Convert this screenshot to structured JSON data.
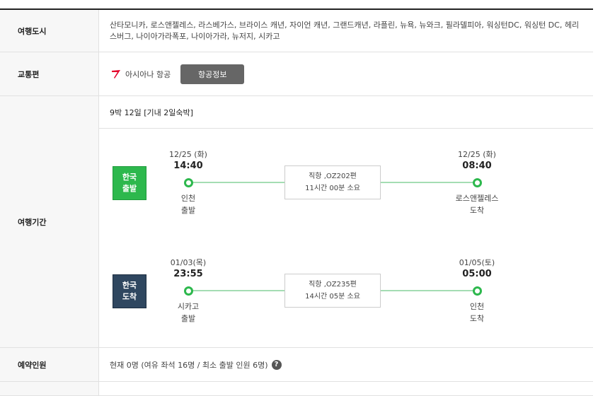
{
  "cities": {
    "label": "여행도시",
    "value": "산타모니카, 로스앤젤레스, 라스베가스, 브라이스 캐년, 자이언 캐년, 그랜드캐년, 라플린, 뉴욕, 뉴와크, 필라델피아, 워싱턴DC, 워싱턴 DC, 헤리스버그, 나이아가라폭포, 나이아가라, 뉴저지, 시카고"
  },
  "transport": {
    "label": "교통편",
    "airline": "아시아나 항공",
    "button": "항공정보"
  },
  "period": {
    "label": "여행기간",
    "duration": "9박 12일 [기내 2일숙박]",
    "departure": {
      "badge_line1": "한국",
      "badge_line2": "출발",
      "from_date": "12/25 (화)",
      "from_time": "14:40",
      "from_place": "인천",
      "from_action": "출발",
      "flight": "직항 ,OZ202편",
      "flight_time": "11시간 00분 소요",
      "to_date": "12/25 (화)",
      "to_time": "08:40",
      "to_place": "로스앤젤레스",
      "to_action": "도착"
    },
    "return": {
      "badge_line1": "한국",
      "badge_line2": "도착",
      "from_date": "01/03(목)",
      "from_time": "23:55",
      "from_place": "시카고",
      "from_action": "출발",
      "flight": "직항 ,OZ235편",
      "flight_time": "14시간 05분 소요",
      "to_date": "01/05(토)",
      "to_time": "05:00",
      "to_place": "인천",
      "to_action": "도착"
    }
  },
  "people": {
    "label": "예약인원",
    "value": "현재 0명 (여유 좌석 16명 / 최소 출발 인원 6명)",
    "help_glyph": "?"
  },
  "colors": {
    "departure_badge": "#2db84d",
    "arrival_badge": "#2f4760",
    "timeline": "#a4ddb3",
    "dot": "#2db84d",
    "airline_red": "#e4002b"
  }
}
